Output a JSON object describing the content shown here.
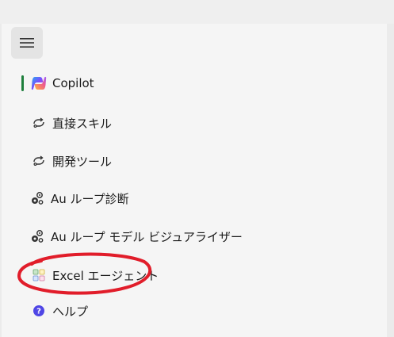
{
  "nav": {
    "items": [
      {
        "label": "Copilot",
        "icon": "copilot-logo-icon",
        "active": true
      },
      {
        "label": "直接スキル",
        "icon": "skill-loop-icon"
      },
      {
        "label": "開発ツール",
        "icon": "skill-loop-icon"
      },
      {
        "label": "Au ループ診断",
        "icon": "gear-group-icon"
      },
      {
        "label": "Au ループ モデル ビジュアライザー",
        "icon": "gear-group-icon"
      },
      {
        "label": "Excel エージェント",
        "icon": "excel-grid-icon"
      },
      {
        "label": "ヘルプ",
        "icon": "help-question-icon"
      }
    ]
  },
  "colors": {
    "active_indicator": "#1e7f3c",
    "annotation_circle": "#e11d2a",
    "help_icon": "#4f46e5"
  }
}
